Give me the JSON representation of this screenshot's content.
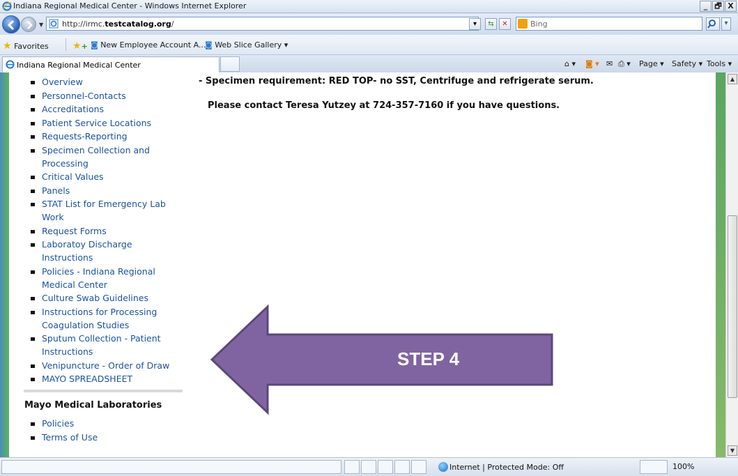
{
  "window": {
    "title": "Indiana Regional Medical Center - Windows Internet Explorer",
    "buttons": [
      "_",
      "🗗",
      "X"
    ]
  },
  "address_bar": {
    "url_prefix": "http://irmc.",
    "url_domain": "testcatalog.org",
    "url_suffix": "/",
    "search_placeholder": "Bing"
  },
  "favorites_bar": {
    "favorites_label": "Favorites",
    "items": [
      "New Employee Account A...",
      "Web Slice Gallery ▾"
    ]
  },
  "tab": {
    "title": "Indiana Regional Medical Center"
  },
  "command_bar": {
    "page": "Page ▾",
    "safety": "Safety ▾",
    "tools": "Tools ▾"
  },
  "sidebar": {
    "items": [
      "Overview",
      "Personnel-Contacts",
      "Accreditations",
      "Patient Service Locations",
      "Requests-Reporting",
      "Specimen Collection and Processing",
      "Critical Values",
      "Panels",
      "STAT List for Emergency Lab Work",
      "Request Forms",
      "Laboratoy Discharge Instructions",
      "Policies - Indiana Regional Medical Center",
      "Culture Swab Guidelines",
      "Instructions for Processing Coagulation Studies",
      "Sputum Collection - Patient Instructions",
      "Venipuncture - Order of Draw",
      "MAYO SPREADSHEET"
    ],
    "section_title": "Mayo Medical Laboratories",
    "section_items": [
      "Policies",
      "Terms of Use"
    ]
  },
  "main": {
    "specimen_text": "-  Specimen requirement:  RED TOP- no SST, Centrifuge and refrigerate serum.",
    "contact_text": "Please contact Teresa Yutzey at 724-357-7160 if you have questions."
  },
  "annotation": {
    "label": "STEP 4",
    "color": "#8064a2"
  },
  "status_bar": {
    "zone": "Internet | Protected Mode: Off",
    "zoom": "100%"
  }
}
